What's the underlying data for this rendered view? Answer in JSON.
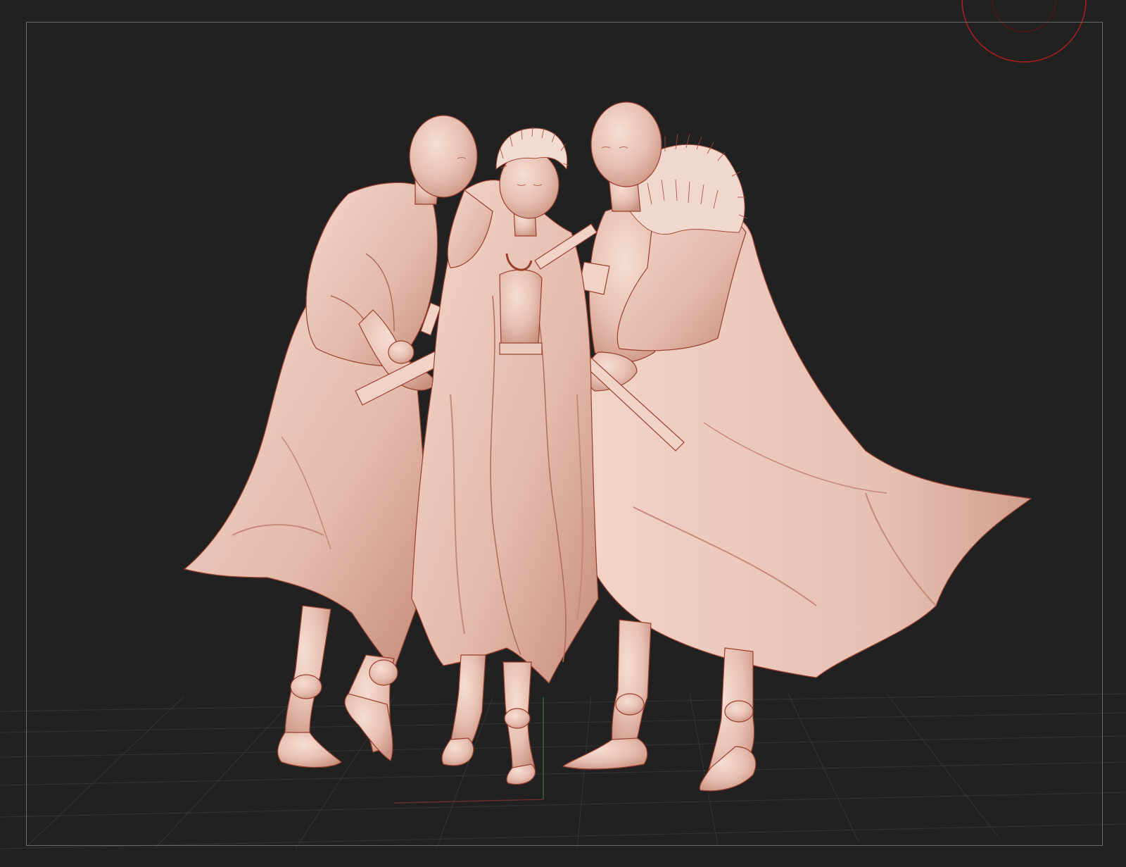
{
  "window": {
    "title": ""
  },
  "viewport": {
    "background": "#212121",
    "frame_color": "#6a6a6a",
    "grid_color": "#3a3a3a",
    "axis_y_color": "#2e6b2e",
    "axis_x_color": "#6b2e2e",
    "navigator_color": "#b01e1e"
  },
  "model": {
    "material_color": "#e9c3b5",
    "shade_color": "#c98f7d",
    "edge_color": "#9a3f2d",
    "figures": [
      "left-figure",
      "center-figure",
      "right-figure"
    ]
  },
  "icons": {
    "navigator": "rotation-gizmo-icon"
  }
}
